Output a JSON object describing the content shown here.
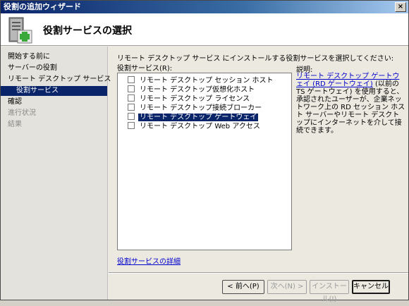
{
  "window": {
    "title": "役割の追加ウィザード",
    "close_label": "×"
  },
  "header": {
    "title": "役割サービスの選択"
  },
  "nav": {
    "items": [
      {
        "label": "開始する前に",
        "state": "normal"
      },
      {
        "label": "サーバーの役割",
        "state": "normal"
      },
      {
        "label": "リモート デスクトップ サービス",
        "state": "normal"
      },
      {
        "label": "役割サービス",
        "state": "selected"
      },
      {
        "label": "確認",
        "state": "normal"
      },
      {
        "label": "進行状況",
        "state": "dim"
      },
      {
        "label": "結果",
        "state": "dim"
      }
    ]
  },
  "main": {
    "instruction": "リモート デスクトップ サービス にインストールする役割サービスを選択してください:",
    "list_label": "役割サービス(R):",
    "services": [
      {
        "label": "リモート デスクトップ セッション ホスト",
        "checked": false,
        "selected": false
      },
      {
        "label": "リモート デスクトップ仮想化ホスト",
        "checked": false,
        "selected": false
      },
      {
        "label": "リモート デスクトップ ライセンス",
        "checked": false,
        "selected": false
      },
      {
        "label": "リモート デスクトップ接続ブローカー",
        "checked": false,
        "selected": false
      },
      {
        "label": "リモート デスクトップ ゲートウェイ",
        "checked": false,
        "selected": true
      },
      {
        "label": "リモート デスクトップ Web アクセス",
        "checked": false,
        "selected": false
      }
    ],
    "description_label": "説明:",
    "description_link": "リモート デスクトップ ゲートウェイ (RD ゲートウェイ)",
    "description_text": " (以前の TS ゲートウェイ) を使用すると、承認されたユーザーが、企業ネットワーク上の RD セッション ホスト サーバーやリモート デスクトップにインターネットを介して接続できます。",
    "details_link": "役割サービスの詳細"
  },
  "buttons": {
    "back": "< 前へ(P)",
    "next": "次へ(N) >",
    "install": "インストール(I)",
    "cancel": "キャンセル"
  },
  "colors": {
    "selection": "#0a246a",
    "link": "#0000cc",
    "titlebar_start": "#0a246a"
  }
}
